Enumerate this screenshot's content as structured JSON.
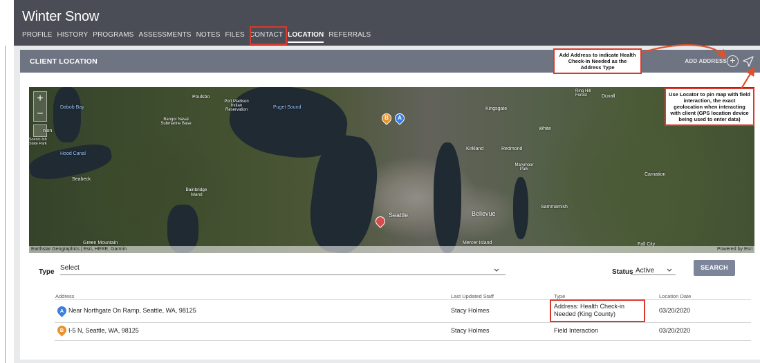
{
  "client": {
    "name": "Winter Snow"
  },
  "nav": {
    "tabs": [
      {
        "label": "PROFILE"
      },
      {
        "label": "HISTORY"
      },
      {
        "label": "PROGRAMS"
      },
      {
        "label": "ASSESSMENTS"
      },
      {
        "label": "NOTES"
      },
      {
        "label": "FILES"
      },
      {
        "label": "CONTACT"
      },
      {
        "label": "LOCATION",
        "active": true
      },
      {
        "label": "REFERRALS"
      }
    ]
  },
  "panel": {
    "title": "CLIENT LOCATION",
    "add_address_label": "ADD ADDRESS"
  },
  "map": {
    "labels": {
      "dabob_bay": "Dabob Bay",
      "poulsbo": "Poulsbo",
      "port_madison": "Port Madison Indian Reservation",
      "puget_sound": "Puget Sound",
      "bangor": "Bangor Naval Submarine Base",
      "union": "nion",
      "brinnon": "Scenic-Ish State Park",
      "hood_canal": "Hood Canal",
      "seabeck": "Seabeck",
      "bainbridge": "Bainbridge Island",
      "ring_hill": "Ring Hill Forest",
      "duvall": "Duvall",
      "kingsgate": "Kingsgate",
      "white": "White",
      "kirkland": "Kirkland",
      "redmond": "Redmond",
      "marymoor": "Marymoor Park",
      "carnation": "Carnation",
      "sammamish": "Sammamish",
      "seattle": "Seattle",
      "bellevue": "Bellevue",
      "green_mountain": "Green Mountain",
      "mercer_island": "Mercer Island",
      "fall_city": "Fall City"
    },
    "credit_left": "Earthstar Geographics | Esri, HERE, Garmin",
    "credit_right": "Powered by Esri",
    "pins": [
      {
        "letter": "B",
        "color": "#e8922e"
      },
      {
        "letter": "A",
        "color": "#3b7de0"
      },
      {
        "letter": "",
        "color": "#d84b4b"
      }
    ]
  },
  "annotations": {
    "add_address_note": "Add Address to indicate Health Check-In Needed as the Address Type",
    "locator_note": "Use Locator to pin map with field interaction, the exact geolocation when interacting with client (GPS location device being used to enter data)"
  },
  "filters": {
    "type_label": "Type",
    "type_value": "Select",
    "status_label": "Status",
    "status_value": "Active",
    "search_label": "SEARCH"
  },
  "table": {
    "headers": [
      "Address",
      "Last Updated Staff",
      "Type",
      "Location Date"
    ],
    "rows": [
      {
        "pin": "A",
        "pin_color": "#3b7de0",
        "address": "Near Northgate On Ramp, Seattle, WA, 98125",
        "staff": "Stacy Holmes",
        "type": "Address: Health Check-in Needed (King County)",
        "date": "03/20/2020"
      },
      {
        "pin": "B",
        "pin_color": "#e8922e",
        "address": "I-5 N, Seattle, WA, 98125",
        "staff": "Stacy Holmes",
        "type": "Field Interaction",
        "date": "03/20/2020"
      }
    ]
  },
  "colors": {
    "highlight": "#d93a2b",
    "header_bg": "#4a4d55",
    "panel_head_bg": "#6f7483",
    "search_btn": "#7d859b"
  }
}
